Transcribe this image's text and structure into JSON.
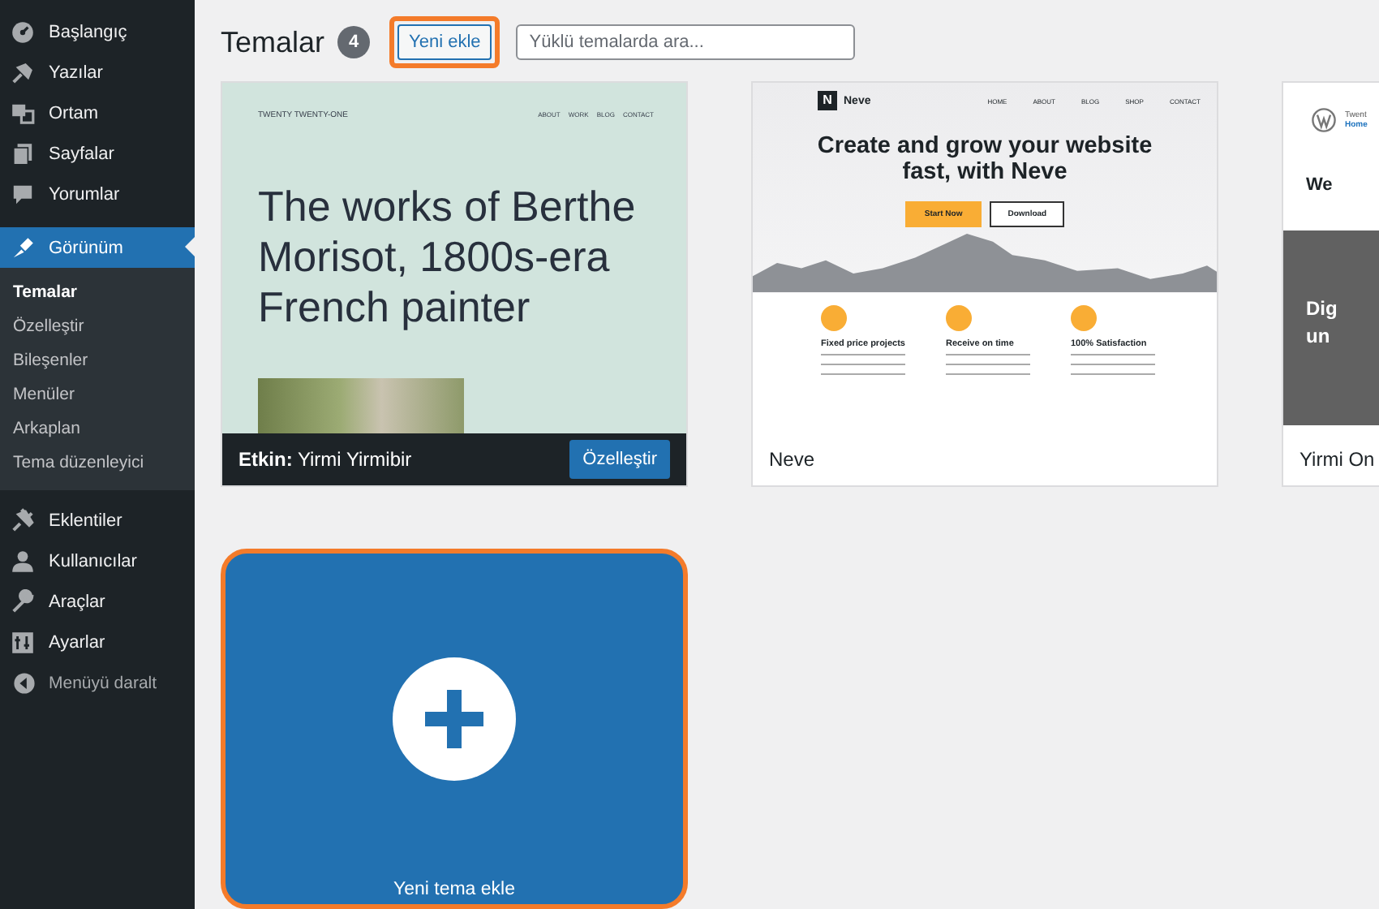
{
  "sidebar": {
    "items": [
      {
        "label": "Başlangıç",
        "selected": false
      },
      {
        "label": "Yazılar",
        "selected": false
      },
      {
        "label": "Ortam",
        "selected": false
      },
      {
        "label": "Sayfalar",
        "selected": false
      },
      {
        "label": "Yorumlar",
        "selected": false
      },
      {
        "label": "Görünüm",
        "selected": true,
        "children": [
          {
            "label": "Temalar",
            "selected": true
          },
          {
            "label": "Özelleştir",
            "selected": false
          },
          {
            "label": "Bileşenler",
            "selected": false
          },
          {
            "label": "Menüler",
            "selected": false
          },
          {
            "label": "Arkaplan",
            "selected": false
          },
          {
            "label": "Tema düzenleyici",
            "selected": false
          }
        ]
      },
      {
        "label": "Eklentiler",
        "selected": false
      },
      {
        "label": "Kullanıcılar",
        "selected": false
      },
      {
        "label": "Araçlar",
        "selected": false
      },
      {
        "label": "Ayarlar",
        "selected": false
      }
    ],
    "collapse_label": "Menüyü daralt"
  },
  "header": {
    "title": "Temalar",
    "count": "4",
    "add_button": "Yeni ekle",
    "search": {
      "placeholder": "Yüklü temalarda ara..."
    }
  },
  "themes": [
    {
      "kind": "twentyone",
      "active": true,
      "active_label": "Etkin:",
      "name": "Yirmi Yirmibir",
      "customize_button": "Özelleştir",
      "preview": {
        "site_title": "TWENTY TWENTY-ONE",
        "nav": [
          "ABOUT",
          "WORK",
          "BLOG",
          "CONTACT"
        ],
        "heading": "The works of Berthe Morisot, 1800s-era French painter"
      }
    },
    {
      "kind": "neve",
      "active": false,
      "name": "Neve",
      "preview": {
        "logo": "N",
        "site_title": "Neve",
        "nav": [
          "HOME",
          "ABOUT",
          "BLOG",
          "SHOP",
          "CONTACT"
        ],
        "heading": "Create and grow your website fast, with Neve",
        "buttons": [
          "Start Now",
          "Download"
        ],
        "features": [
          "Fixed price projects",
          "Receive on time",
          "100% Satisfaction"
        ]
      }
    },
    {
      "kind": "twentytwenty",
      "active": false,
      "name": "Yirmi On",
      "preview": {
        "site_title": "Twent",
        "nav": [
          "Home"
        ],
        "heading": "We",
        "banner": [
          "Dig",
          "un"
        ]
      }
    }
  ],
  "add_theme": {
    "label": "Yeni tema ekle"
  }
}
